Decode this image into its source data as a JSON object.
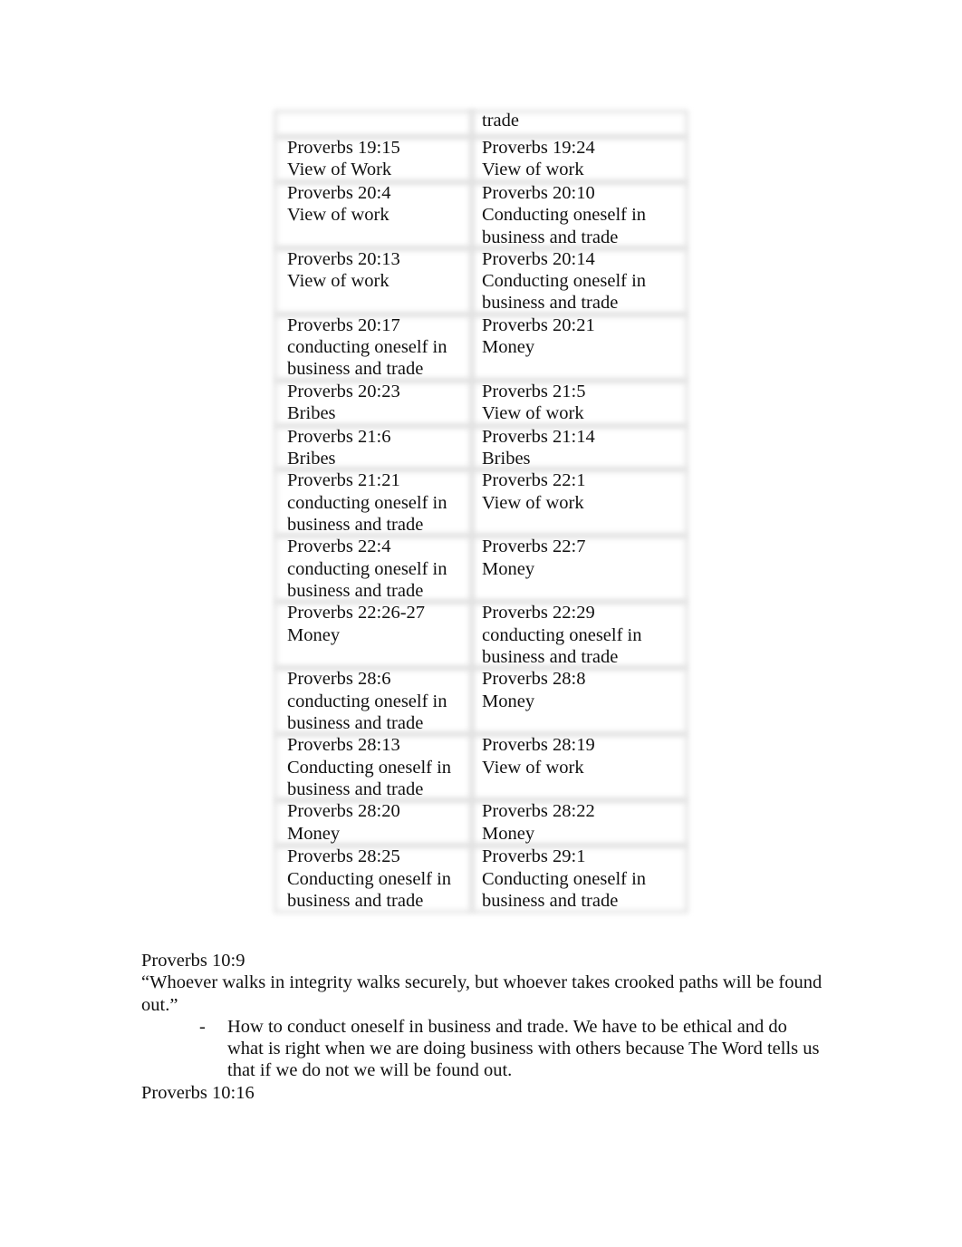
{
  "table": {
    "rows": [
      {
        "left": {
          "ref": "",
          "topic": ""
        },
        "right": {
          "ref": "trade",
          "topic": ""
        }
      },
      {
        "left": {
          "ref": "Proverbs 19:15",
          "topic": "View of Work"
        },
        "right": {
          "ref": "Proverbs 19:24",
          "topic": "View of work"
        }
      },
      {
        "left": {
          "ref": "Proverbs 20:4",
          "topic": "View of work"
        },
        "right": {
          "ref": "Proverbs 20:10",
          "topic": "Conducting oneself in business and trade"
        }
      },
      {
        "left": {
          "ref": "Proverbs 20:13",
          "topic": "View of work"
        },
        "right": {
          "ref": "Proverbs 20:14",
          "topic": "Conducting oneself in business and trade"
        }
      },
      {
        "left": {
          "ref": "Proverbs 20:17",
          "topic": "conducting oneself in business and trade"
        },
        "right": {
          "ref": "Proverbs 20:21",
          "topic": "Money"
        }
      },
      {
        "left": {
          "ref": "Proverbs 20:23",
          "topic": "Bribes"
        },
        "right": {
          "ref": "Proverbs 21:5",
          "topic": "View of work"
        }
      },
      {
        "left": {
          "ref": "Proverbs 21:6",
          "topic": "Bribes"
        },
        "right": {
          "ref": "Proverbs 21:14",
          "topic": "Bribes"
        }
      },
      {
        "left": {
          "ref": "Proverbs 21:21",
          "topic": "conducting oneself in business and trade"
        },
        "right": {
          "ref": "Proverbs 22:1",
          "topic": "View of work"
        }
      },
      {
        "left": {
          "ref": "Proverbs 22:4",
          "topic": "conducting oneself in business and trade"
        },
        "right": {
          "ref": "Proverbs 22:7",
          "topic": "Money"
        }
      },
      {
        "left": {
          "ref": "Proverbs 22:26-27",
          "topic": "Money"
        },
        "right": {
          "ref": "Proverbs 22:29",
          "topic": "conducting oneself in business and trade"
        }
      },
      {
        "left": {
          "ref": "Proverbs 28:6",
          "topic": "conducting oneself in business and trade"
        },
        "right": {
          "ref": "Proverbs 28:8",
          "topic": "Money"
        }
      },
      {
        "left": {
          "ref": "Proverbs 28:13",
          "topic": "Conducting oneself in business and trade"
        },
        "right": {
          "ref": "Proverbs 28:19",
          "topic": "View of work"
        }
      },
      {
        "left": {
          "ref": "Proverbs 28:20",
          "topic": "Money"
        },
        "right": {
          "ref": "Proverbs 28:22",
          "topic": "Money"
        }
      },
      {
        "left": {
          "ref": "Proverbs 28:25",
          "topic": "Conducting oneself in business and trade"
        },
        "right": {
          "ref": "Proverbs 29:1",
          "topic": "Conducting oneself in business and trade"
        }
      }
    ]
  },
  "notes": {
    "heading1": "Proverbs 10:9",
    "quote": "“Whoever walks in integrity walks securely, but whoever takes crooked paths will be found out.”",
    "bullet_marker": "-",
    "bullet_text": "How to conduct oneself in business and trade. We have to be ethical and do what is right when we are doing business with others because The Word tells us that if we do not we will be found out.",
    "heading2": "Proverbs 10:16"
  }
}
